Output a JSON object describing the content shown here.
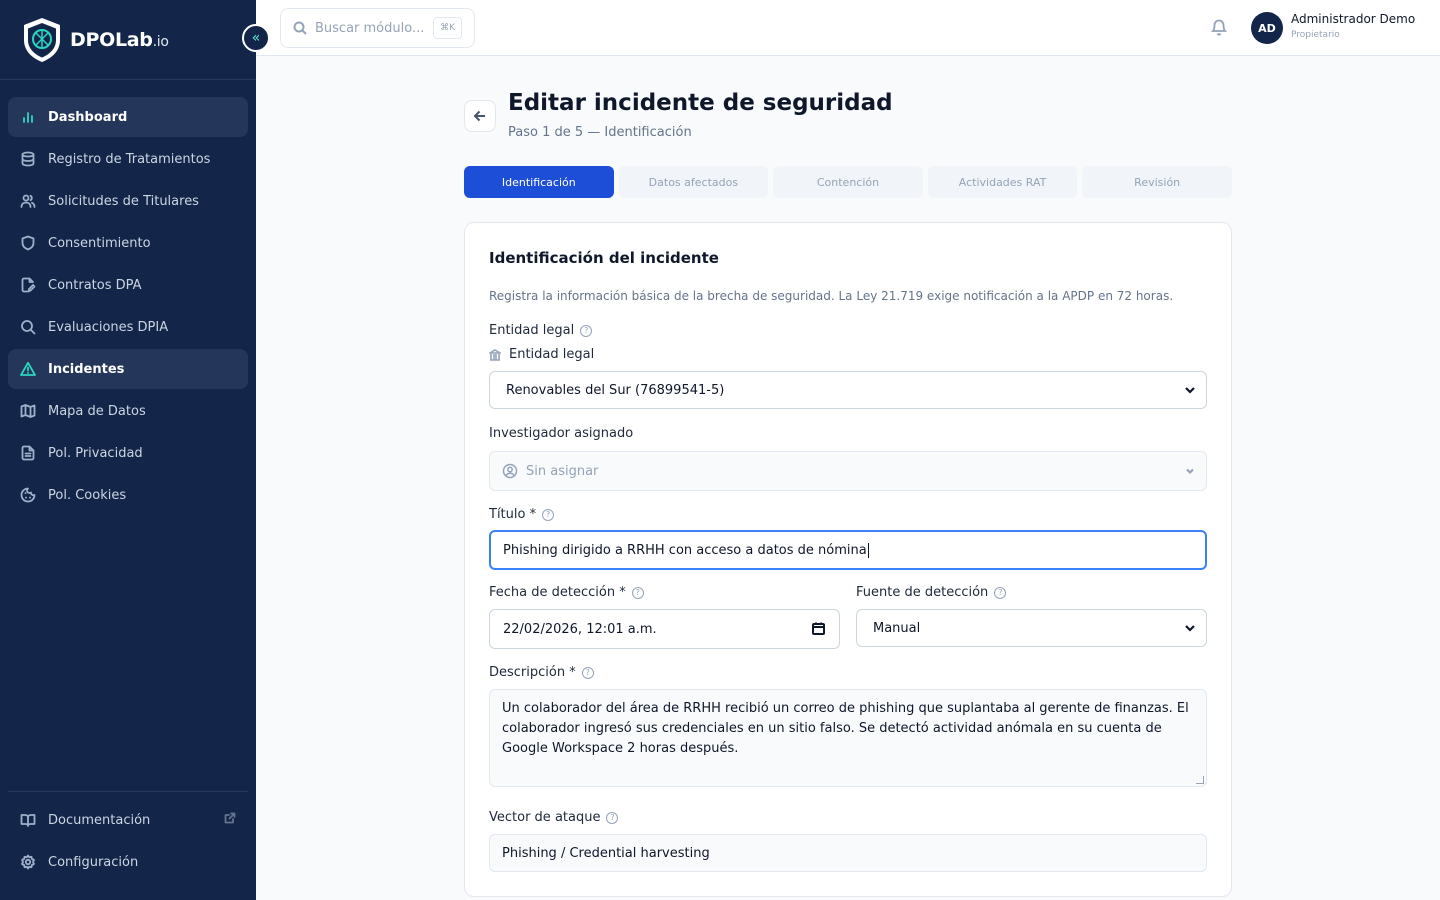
{
  "brand": {
    "name": "DPOLab",
    "suffix": ".io"
  },
  "sidebar": {
    "collapse_label": "«",
    "items": [
      {
        "label": "Dashboard",
        "icon": "bar-chart-icon",
        "active": true
      },
      {
        "label": "Registro de Tratamientos",
        "icon": "database-icon"
      },
      {
        "label": "Solicitudes de Titulares",
        "icon": "users-icon"
      },
      {
        "label": "Consentimiento",
        "icon": "shield-icon"
      },
      {
        "label": "Contratos DPA",
        "icon": "file-edit-icon"
      },
      {
        "label": "Evaluaciones DPIA",
        "icon": "search-icon"
      },
      {
        "label": "Incidentes",
        "icon": "alert-triangle-icon",
        "active": true
      },
      {
        "label": "Mapa de Datos",
        "icon": "map-icon"
      },
      {
        "label": "Pol. Privacidad",
        "icon": "file-text-icon"
      },
      {
        "label": "Pol. Cookies",
        "icon": "cookie-icon"
      }
    ],
    "bottom": [
      {
        "label": "Documentación",
        "icon": "book-icon"
      },
      {
        "label": "Configuración",
        "icon": "gear-icon"
      }
    ]
  },
  "topbar": {
    "search_placeholder": "Buscar módulo...",
    "shortcut": "⌘K",
    "user": {
      "initials": "AD",
      "name": "Administrador Demo",
      "role": "Propietario"
    }
  },
  "page": {
    "title": "Editar incidente de seguridad",
    "subtitle": "Paso 1 de 5 — Identificación"
  },
  "steps": [
    {
      "label": "Identificación",
      "active": true
    },
    {
      "label": "Datos afectados"
    },
    {
      "label": "Contención"
    },
    {
      "label": "Actividades RAT"
    },
    {
      "label": "Revisión"
    }
  ],
  "form": {
    "title": "Identificación del incidente",
    "description": "Registra la información básica de la brecha de seguridad. La Ley 21.719 exige notificación a la APDP en 72 horas.",
    "entity_label": "Entidad legal",
    "entity_sublabel": "Entidad legal",
    "entity_value": "Renovables del Sur (76899541-5)",
    "investigator_label": "Investigador asignado",
    "investigator_value": "Sin asignar",
    "title_label": "Título *",
    "title_value": "Phishing dirigido a RRHH con acceso a datos de nómina",
    "date_label": "Fecha de detección *",
    "date_value": "22/02/2026, 12:01 a.m.",
    "source_label": "Fuente de detección",
    "source_value": "Manual",
    "desc_label": "Descripción *",
    "desc_value": "Un colaborador del área de RRHH recibió un correo de phishing que suplantaba al gerente de finanzas. El colaborador ingresó sus credenciales en un sitio falso. Se detectó actividad anómala en su cuenta de Google Workspace 2 horas después.",
    "vector_label": "Vector de ataque",
    "vector_value": "Phishing / Credential harvesting",
    "help_glyph": "?"
  },
  "colors": {
    "sidebar": "#13264a",
    "accent": "#1d4ed8",
    "teal": "#2dd4bf"
  }
}
